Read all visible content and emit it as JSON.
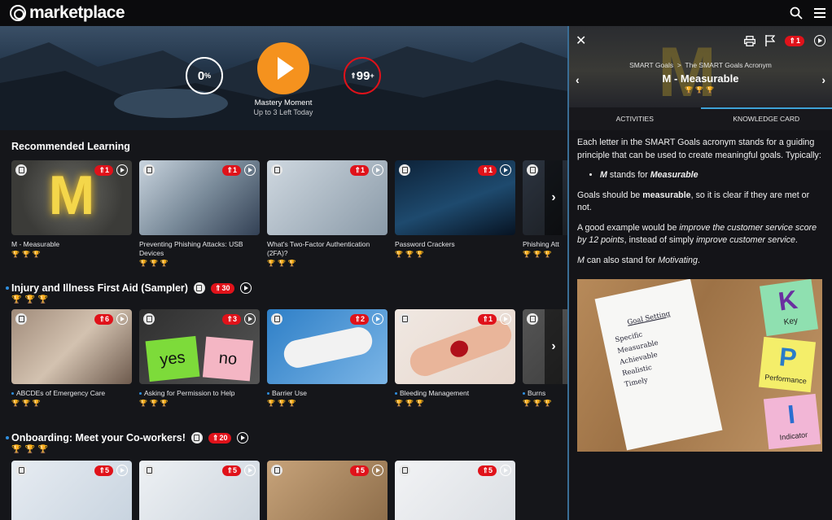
{
  "app": {
    "title": "marketplace"
  },
  "hero": {
    "progress_pct": "0",
    "progress_unit": "%",
    "points": "99",
    "points_plus": "+",
    "mastery_title": "Mastery Moment",
    "mastery_sub": "Up to 3 Left Today"
  },
  "sections": [
    {
      "title": "Recommended Learning",
      "cards": [
        {
          "title": "M - Measurable",
          "badge": "1"
        },
        {
          "title": "Preventing Phishing Attacks: USB Devices",
          "badge": "1"
        },
        {
          "title": "What's Two-Factor Authentication (2FA)?",
          "badge": "1"
        },
        {
          "title": "Password Crackers",
          "badge": "1"
        },
        {
          "title": "Phishing Att",
          "badge": ""
        }
      ]
    },
    {
      "title": "Injury and Illness First Aid (Sampler)",
      "badge": "30",
      "cards": [
        {
          "title": "ABCDEs of Emergency Care",
          "badge": "6"
        },
        {
          "title": "Asking for Permission to Help",
          "badge": "3"
        },
        {
          "title": "Barrier Use",
          "badge": "2"
        },
        {
          "title": "Bleeding Management",
          "badge": "1"
        },
        {
          "title": "Burns",
          "badge": ""
        }
      ]
    },
    {
      "title": "Onboarding: Meet your Co-workers!",
      "badge": "20",
      "cards": [
        {
          "badge": "5"
        },
        {
          "badge": "5"
        },
        {
          "badge": "5"
        },
        {
          "badge": "5"
        }
      ]
    }
  ],
  "panel": {
    "header_badge": "1",
    "crumb_parent": "SMART Goals",
    "crumb_sep": ">",
    "crumb_current": "The SMART Goals Acronym",
    "title": "M - Measurable",
    "tabs": [
      "ACTIVITIES",
      "KNOWLEDGE CARD"
    ],
    "p1": "Each letter in the SMART Goals acronym stands for a guiding principle that can be used to create meaningful goals. Typically:",
    "li_letter": "M",
    "li_mid": " stands for ",
    "li_word": "Measurable",
    "p2a": "Goals should be ",
    "p2b": "measurable",
    "p2c": ", so it is clear if they are met or not.",
    "p3a": "A good example would be ",
    "p3b": "improve the customer service score by 12 points",
    "p3c": ", instead of simply ",
    "p3d": "improve customer service",
    "p3e": ".",
    "p4a": "M",
    "p4b": " can also stand for ",
    "p4c": "Motivating",
    "p4d": ".",
    "image": {
      "notebook_title": "Goal Setting",
      "notebook_lines": [
        "Specific",
        "Measurable",
        "Achievable",
        "Realistic",
        "Timely"
      ],
      "notes": [
        {
          "letter": "K",
          "label": "Key"
        },
        {
          "letter": "P",
          "label": "Performance"
        },
        {
          "letter": "I",
          "label": "Indicator"
        }
      ]
    }
  },
  "thumb_text": {
    "M": "M",
    "yes": "yes",
    "no": "no",
    "check": "✓",
    "x": "×",
    "q": "?"
  }
}
